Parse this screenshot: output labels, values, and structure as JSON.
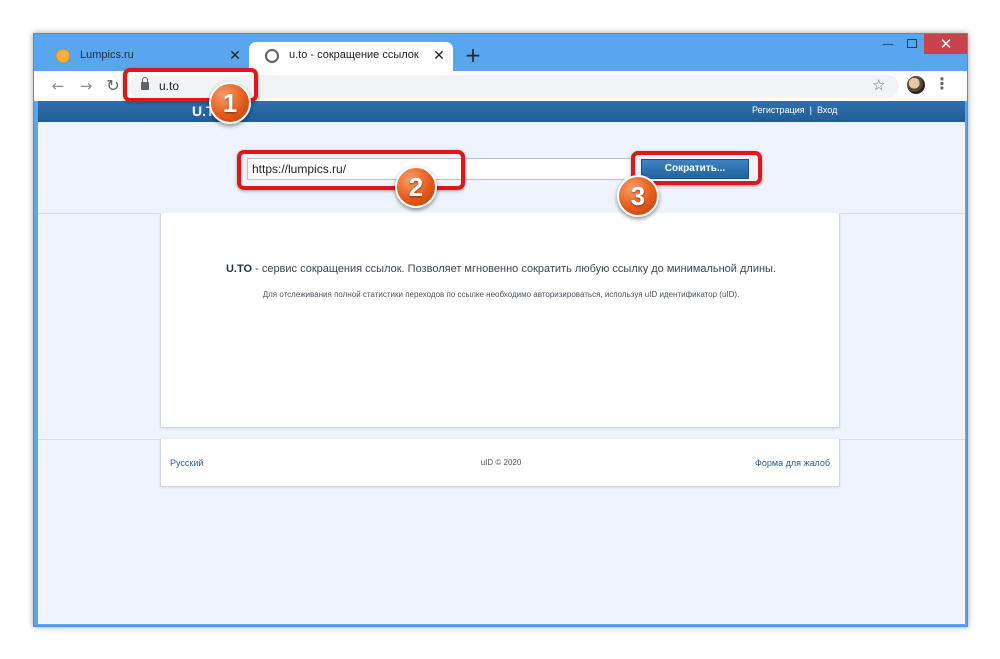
{
  "browser": {
    "tabs": [
      {
        "title": "Lumpics.ru",
        "active": false
      },
      {
        "title": "u.to - сокращение ссылок",
        "active": true
      }
    ],
    "new_tab_label": "+",
    "close_glyph": "✕",
    "address": "u.to"
  },
  "site": {
    "logo": "U.T",
    "header_links": {
      "register": "Регистрация",
      "separator": "|",
      "login": "Вход"
    },
    "url_input_value": "https://lumpics.ru/",
    "shorten_button": "Сократить...",
    "description": {
      "brand": "U.TO",
      "text": " - сервис сокращения ссылок. Позволяет мгновенно сократить любую ссылку до минимальной длины."
    },
    "description_sub": "Для отслеживания полной статистики переходов по ссылке необходимо авторизироваться, используя uID идентификатор (uID).",
    "footer": {
      "language": "Русский",
      "copyright": "uID © 2020",
      "complaint_link": "Форма для жалоб"
    }
  },
  "annotations": {
    "step1": "1",
    "step2": "2",
    "step3": "3"
  },
  "colors": {
    "highlight": "#e2151b",
    "badge": "#e55a1a",
    "site_header": "#2f6fae",
    "window_frame": "#5aa6ee"
  }
}
